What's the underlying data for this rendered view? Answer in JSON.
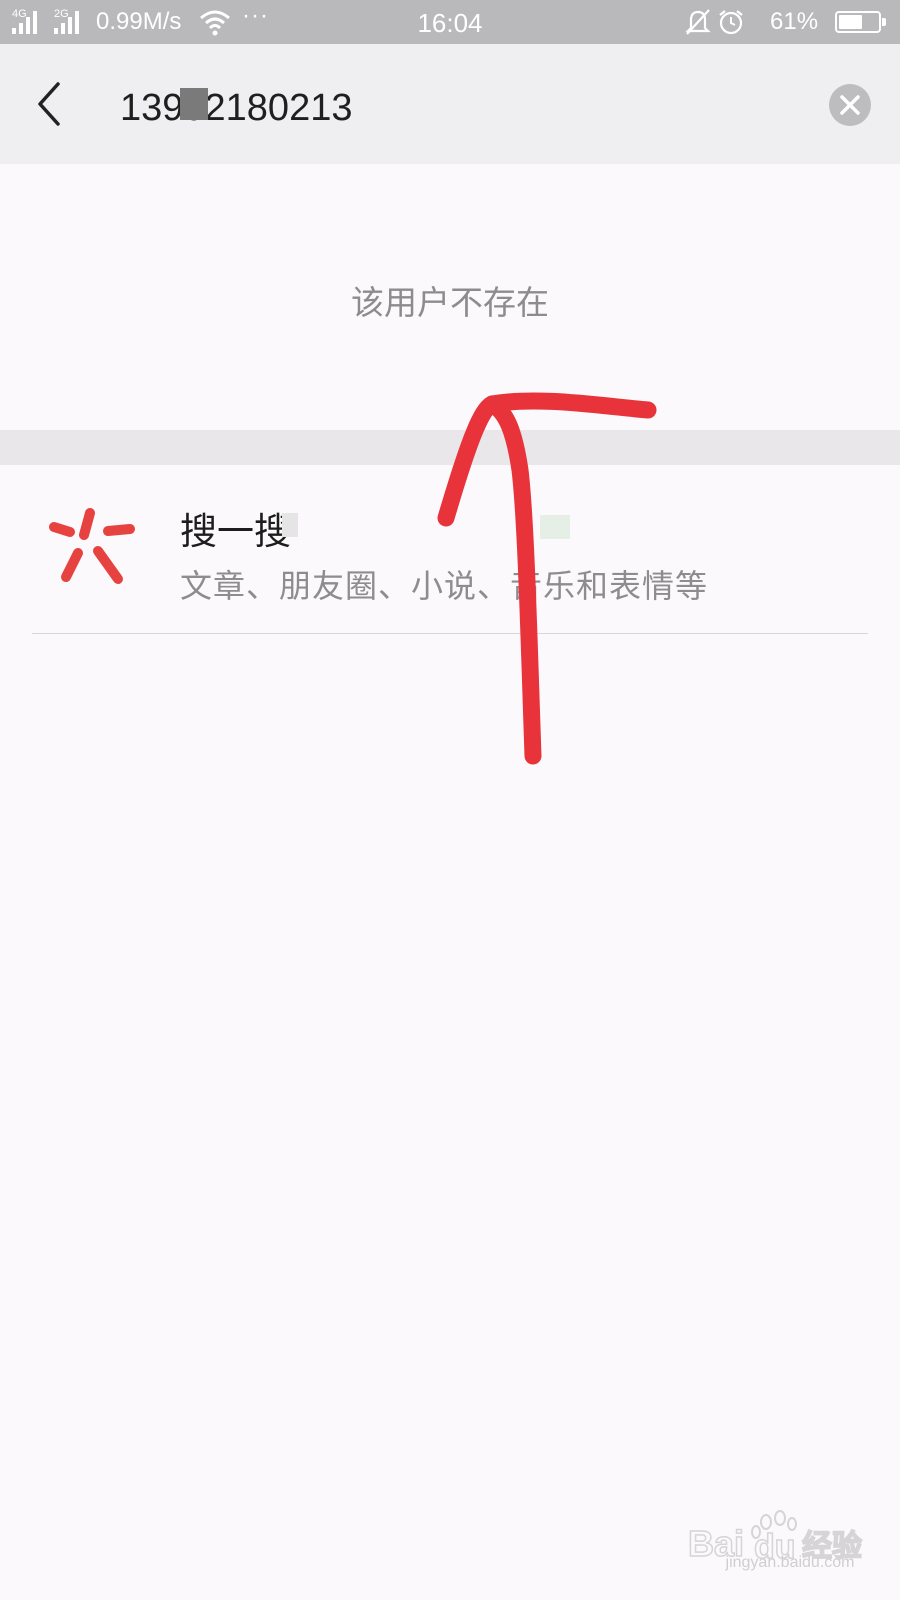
{
  "status_bar": {
    "network_1": "4G",
    "network_2": "2G",
    "speed": "0.99M/s",
    "more": "···",
    "time": "16:04",
    "battery_percent": "61%",
    "battery_level": 0.61
  },
  "search": {
    "query": "13902180213",
    "underline_color": "#5fc255"
  },
  "result": {
    "not_found_message": "该用户不存在"
  },
  "sou_yi_sou": {
    "title": "搜一搜",
    "subtitle": "文章、朋友圈、小说、音乐和表情等",
    "icon_color": "#e64340"
  },
  "annotation": {
    "color": "#e8333a"
  },
  "watermark": {
    "brand": "Baidu经验",
    "url": "jingyan.baidu.com"
  }
}
